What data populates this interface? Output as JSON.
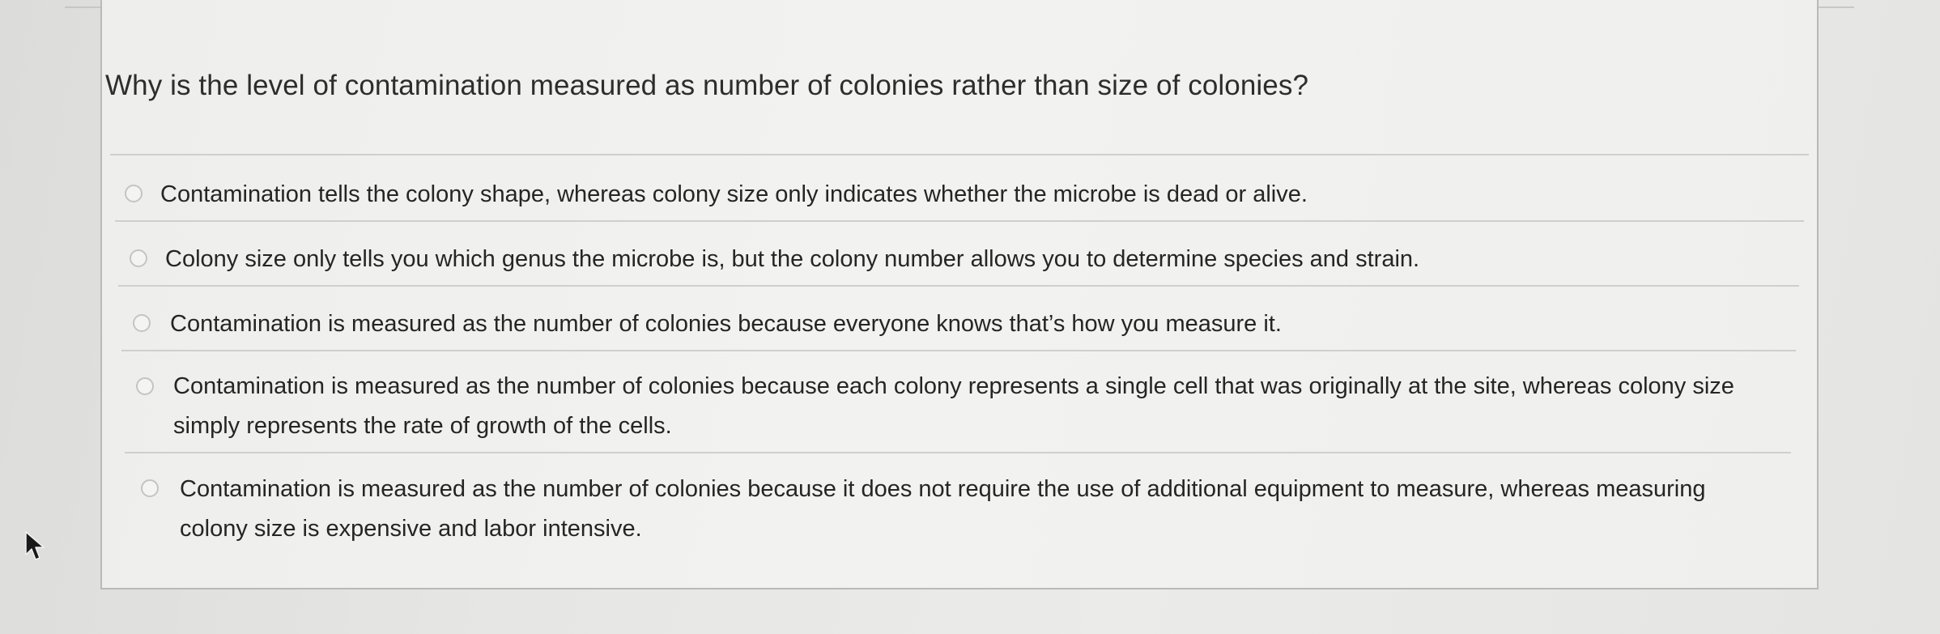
{
  "question": {
    "text": "Why is the level of contamination measured as number of colonies rather than size of colonies?"
  },
  "options": [
    {
      "label": "Contamination tells the colony shape, whereas colony size only indicates whether the microbe is dead or alive.",
      "selected": false
    },
    {
      "label": "Colony size only tells you which genus the microbe is, but the colony number allows you to determine species and strain.",
      "selected": false
    },
    {
      "label": "Contamination is measured as the number of colonies because everyone knows that’s how you measure it.",
      "selected": false
    },
    {
      "label": "Contamination is measured as the number of colonies because each colony represents a single cell that was originally at the site, whereas colony size simply represents the rate of growth of the cells.",
      "selected": false
    },
    {
      "label": "Contamination is measured as the number of colonies because it does not require the use of additional equipment to measure, whereas measuring colony size is expensive and labor intensive.",
      "selected": false
    }
  ],
  "icons": {
    "cursor": "mouse-pointer-icon",
    "radio": "radio-button-icon"
  },
  "colors": {
    "background": "#e6e6e4",
    "card": "#f1f1ef",
    "text": "#2d2d2d",
    "divider": "#cfcfcd"
  }
}
